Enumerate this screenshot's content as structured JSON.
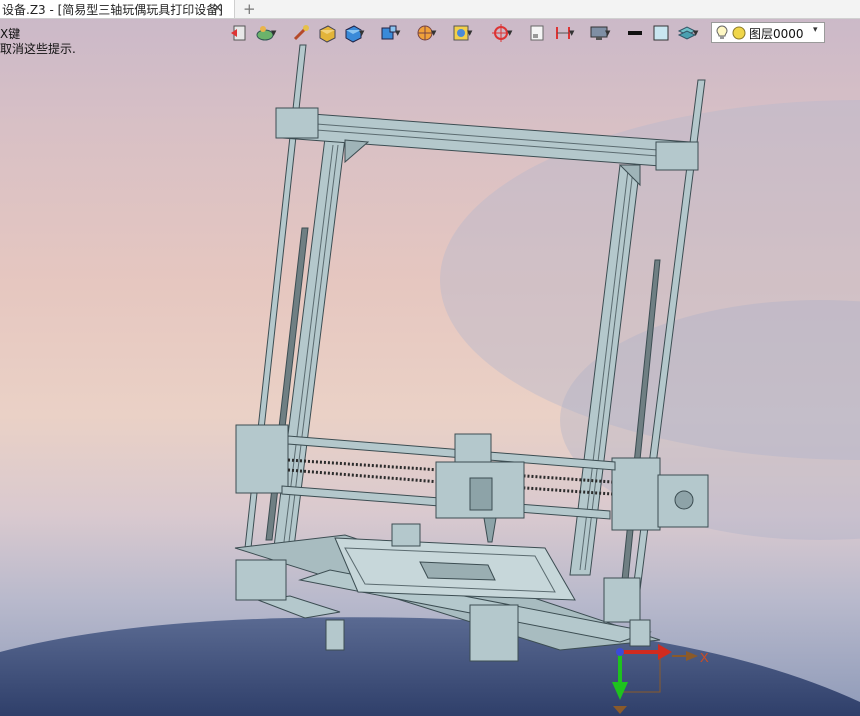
{
  "tab": {
    "title": "设备.Z3 - [简易型三轴玩偶玩具打印设备]",
    "close": "✕",
    "add": "+"
  },
  "hints": [
    "X键",
    "取消这些提示."
  ],
  "toolbar": {
    "icons": [
      "exit-icon",
      "render-mode-icon",
      "brush-icon",
      "box-shaded-icon",
      "box-blue-icon",
      "view-orient-icon",
      "display-style-icon",
      "snap-filter-icon",
      "target-icon",
      "sheet-icon",
      "dimension-icon",
      "monitor-icon",
      "color-black-icon",
      "color-swatch-icon",
      "layers-icon"
    ]
  },
  "layer_selector": {
    "label": "图层0000",
    "dropdown": "▾"
  },
  "triad": {
    "x_label": "X"
  },
  "colors": {
    "model": "#b4c8cc",
    "model_dark": "#3c4d52",
    "floor": "#3e4f7a",
    "accent_red": "#d12b1f",
    "accent_green": "#1ec21e"
  }
}
